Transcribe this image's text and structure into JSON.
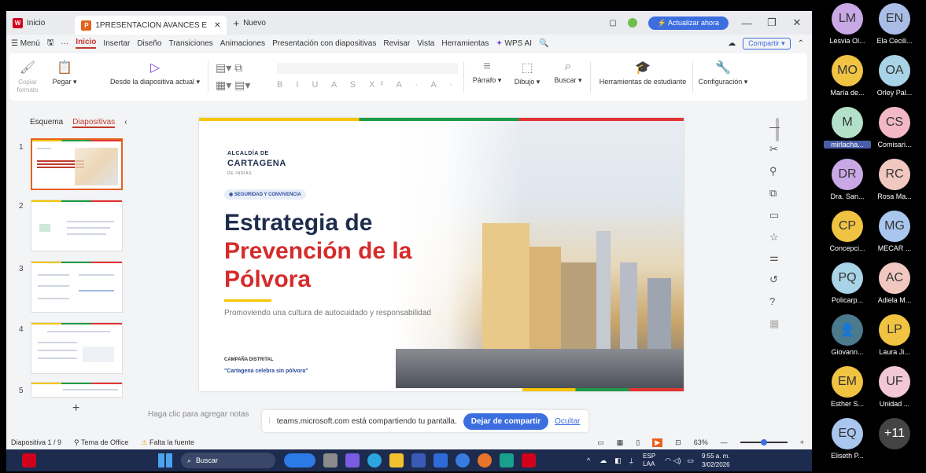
{
  "title_bar": {
    "tab_home": "Inicio",
    "tab_doc": "1PRESENTACION AVANCES E",
    "tab_new": "Nuevo",
    "update_label": "Actualizar ahora"
  },
  "menu": {
    "menu_label": "Menú",
    "items": [
      "Inicio",
      "Insertar",
      "Diseño",
      "Transiciones",
      "Animaciones",
      "Presentación con diapositivas",
      "Revisar",
      "Vista",
      "Herramientas",
      "WPS AI"
    ],
    "share": "Compartir"
  },
  "ribbon": {
    "copy_format": "Copiar formato",
    "paste": "Pegar",
    "from_current": "Desde la diapositiva actual",
    "paragraph": "Párrafo",
    "drawing": "Dibujo",
    "search": "Buscar",
    "student_tools": "Herramientas de estudiante",
    "settings": "Configuración"
  },
  "panel": {
    "outline_tab": "Esquema",
    "slides_tab": "Diapositivas",
    "thumbs": [
      "1",
      "2",
      "3",
      "4",
      "5"
    ]
  },
  "slide": {
    "logo_small": "ALCALDÍA DE",
    "logo_big": "CARTAGENA",
    "logo_sub": "DE INDIAS",
    "pill": "SEGURIDAD Y CONVIVENCIA",
    "title_line1": "Estrategia de",
    "title_line2": "Prevención de la",
    "title_line3": "Pólvora",
    "tagline": "Promoviendo una cultura de autocuidado y responsabilidad",
    "campaign_label": "CAMPAÑA DISTRITAL",
    "campaign_quote": "\"Cartagena celebra sin pólvora\"",
    "colors": {
      "dark": "#1f2d4d",
      "red": "#d62b2b"
    }
  },
  "notes_placeholder": "Haga clic para agregar notas",
  "share_bar": {
    "message": "teams.microsoft.com está compartiendo tu pantalla.",
    "stop": "Dejar de compartir",
    "hide": "Ocultar"
  },
  "status": {
    "slide_pos": "Diapositiva 1 / 9",
    "theme": "Tema de Office",
    "missing_font": "Falta la fuente",
    "zoom": "63%"
  },
  "taskbar": {
    "search": "Buscar",
    "lang1": "ESP",
    "lang2": "LAA",
    "time": "9:55 a. m.",
    "date": "3/02/2026"
  },
  "participants": [
    {
      "initials": "LM",
      "name": "Lesvia Ol...",
      "color": "#c9a8e6"
    },
    {
      "initials": "EN",
      "name": "Ela Cecili...",
      "color": "#a9bde6"
    },
    {
      "initials": "MO",
      "name": "María de...",
      "color": "#f1c343"
    },
    {
      "initials": "OA",
      "name": "Orley Pal...",
      "color": "#a9d3e6"
    },
    {
      "initials": "M",
      "name": "mirlacha...",
      "color": "#b2e0c8"
    },
    {
      "initials": "CS",
      "name": "Comisari...",
      "color": "#f2b8c6"
    },
    {
      "initials": "DR",
      "name": "Dra. San...",
      "color": "#c9a8e6"
    },
    {
      "initials": "RC",
      "name": "Rosa Ma...",
      "color": "#f0c8c0"
    },
    {
      "initials": "CP",
      "name": "Concepci...",
      "color": "#f1c343"
    },
    {
      "initials": "MG",
      "name": "MECAR ...",
      "color": "#a9c6ee"
    },
    {
      "initials": "PQ",
      "name": "Policarp...",
      "color": "#a9d3e6"
    },
    {
      "initials": "AC",
      "name": "Adiela M...",
      "color": "#f0c8c0"
    },
    {
      "initials": "",
      "name": "Giovann...",
      "color": "#4a7a8c"
    },
    {
      "initials": "LP",
      "name": "Laura Ji...",
      "color": "#f1c343"
    },
    {
      "initials": "EM",
      "name": "Esther S...",
      "color": "#f1c343"
    },
    {
      "initials": "UF",
      "name": "Unidad ...",
      "color": "#f2c8d6"
    },
    {
      "initials": "EQ",
      "name": "Eliseth P...",
      "color": "#a9c6ee"
    },
    {
      "initials": "+11",
      "name": "",
      "color": "#444"
    }
  ]
}
